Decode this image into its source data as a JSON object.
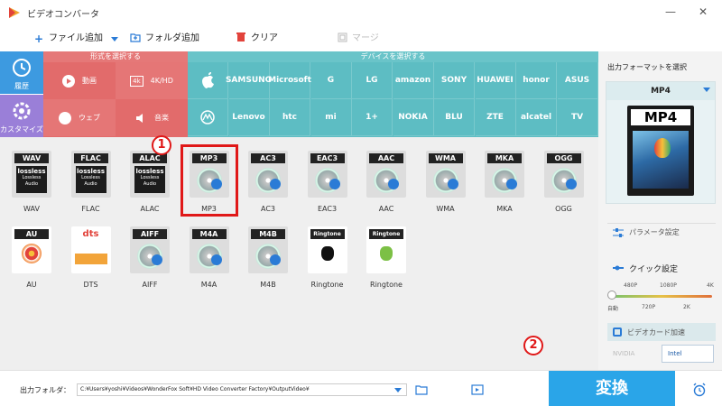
{
  "window": {
    "title": "ビデオコンバータ",
    "minimize": "—",
    "close": "✕"
  },
  "toolbar": {
    "add_file": "ファイル追加",
    "add_folder": "フォルダ追加",
    "clear": "クリア",
    "merge": "マージ"
  },
  "categories": {
    "history": "履歴",
    "custom": "カスタマイズ",
    "format_header": "形式を選択する",
    "device_header": "デバイスを選択する",
    "format_tiles": [
      {
        "label": "動画"
      },
      {
        "label": "4K/HD"
      },
      {
        "label": "ウェブ"
      },
      {
        "label": "音楽"
      }
    ]
  },
  "devices": {
    "row1": [
      "",
      "SAMSUNG",
      "Microsoft",
      "G",
      "LG",
      "amazon",
      "SONY",
      "HUAWEI",
      "honor",
      "ASUS"
    ],
    "row2": [
      "",
      "Lenovo",
      "htc",
      "mi",
      "1+",
      "NOKIA",
      "BLU",
      "ZTE",
      "alcatel",
      "TV"
    ]
  },
  "formats": {
    "row1": [
      {
        "tag": "WAV",
        "caption": "WAV",
        "kind": "lossless"
      },
      {
        "tag": "FLAC",
        "caption": "FLAC",
        "kind": "lossless"
      },
      {
        "tag": "ALAC",
        "caption": "ALAC",
        "kind": "lossless"
      },
      {
        "tag": "MP3",
        "caption": "MP3",
        "kind": "disc",
        "selected": true
      },
      {
        "tag": "AC3",
        "caption": "AC3",
        "kind": "disc"
      },
      {
        "tag": "EAC3",
        "caption": "EAC3",
        "kind": "disc"
      },
      {
        "tag": "AAC",
        "caption": "AAC",
        "kind": "disc"
      },
      {
        "tag": "WMA",
        "caption": "WMA",
        "kind": "disc"
      },
      {
        "tag": "MKA",
        "caption": "MKA",
        "kind": "disc"
      },
      {
        "tag": "OGG",
        "caption": "OGG",
        "kind": "disc"
      }
    ],
    "row2": [
      {
        "tag": "AU",
        "caption": "AU",
        "kind": "au"
      },
      {
        "tag": "dts",
        "caption": "DTS",
        "kind": "dts"
      },
      {
        "tag": "AIFF",
        "caption": "AIFF",
        "kind": "disc"
      },
      {
        "tag": "M4A",
        "caption": "M4A",
        "kind": "disc"
      },
      {
        "tag": "M4B",
        "caption": "M4B",
        "kind": "disc"
      },
      {
        "tag": "Ringtone",
        "caption": "Ringtone",
        "kind": "apple"
      },
      {
        "tag": "Ringtone",
        "caption": "Ringtone",
        "kind": "android"
      }
    ],
    "lossless_text": "lossless",
    "lossless_sub": "Lossless Audio"
  },
  "markers": {
    "one": "1",
    "two": "2"
  },
  "right_panel": {
    "title": "出力フォーマットを選択",
    "selected_format": "MP4",
    "preview_tag": "MP4",
    "param_settings": "パラメータ設定",
    "quick_settings": "クイック設定",
    "ticks_top": [
      "480P",
      "1080P",
      "4K"
    ],
    "ticks_bottom": [
      "自動",
      "720P",
      "2K"
    ],
    "gpu_accel": "ビデオカード加速",
    "nvidia": "NVIDIA",
    "intel": "Intel"
  },
  "bottom": {
    "output_label": "出力フォルダ：",
    "output_path": "C:¥Users¥yoshi¥Videos¥WonderFox Soft¥HD Video Converter Factory¥OutputVideo¥",
    "convert": "変換"
  }
}
